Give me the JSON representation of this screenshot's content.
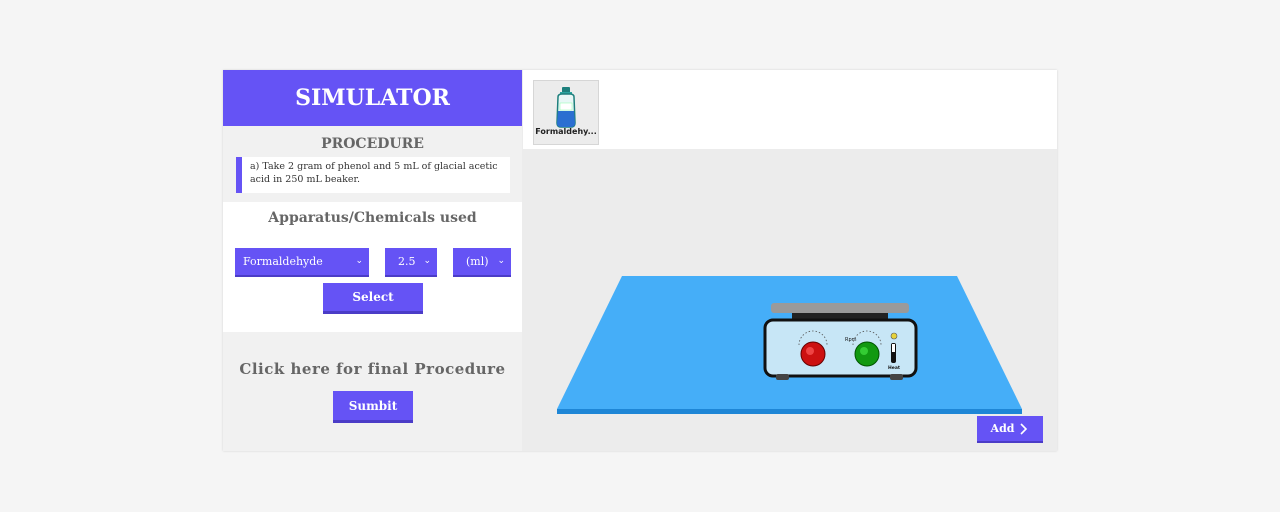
{
  "app": {
    "title": "SIMULATOR"
  },
  "procedure": {
    "heading": "PROCEDURE",
    "step_text": "a) Take 2 gram of phenol and 5 mL of glacial acetic acid in 250 mL beaker."
  },
  "apparatus": {
    "heading": "Apparatus/Chemicals used",
    "chemical_select": {
      "value": "Formaldehyde"
    },
    "amount_select": {
      "value": "2.5"
    },
    "unit_select": {
      "value": "(ml)"
    },
    "select_button": "Select"
  },
  "final": {
    "heading": "Click here for final Procedure",
    "submit_button": "Sumbit"
  },
  "chemicals_tray": {
    "items": [
      {
        "label": "Formaldehy...",
        "icon": "bottle-icon"
      }
    ]
  },
  "workbench": {
    "hotplate_labels": {
      "heat": "Heat",
      "rpm": "Rpm"
    },
    "add_button": "Add",
    "add_icon": "chevron-right-icon"
  },
  "colors": {
    "accent": "#6553f5",
    "table": "#45aef8",
    "knob_left": "#cc1111",
    "knob_right": "#119911"
  }
}
